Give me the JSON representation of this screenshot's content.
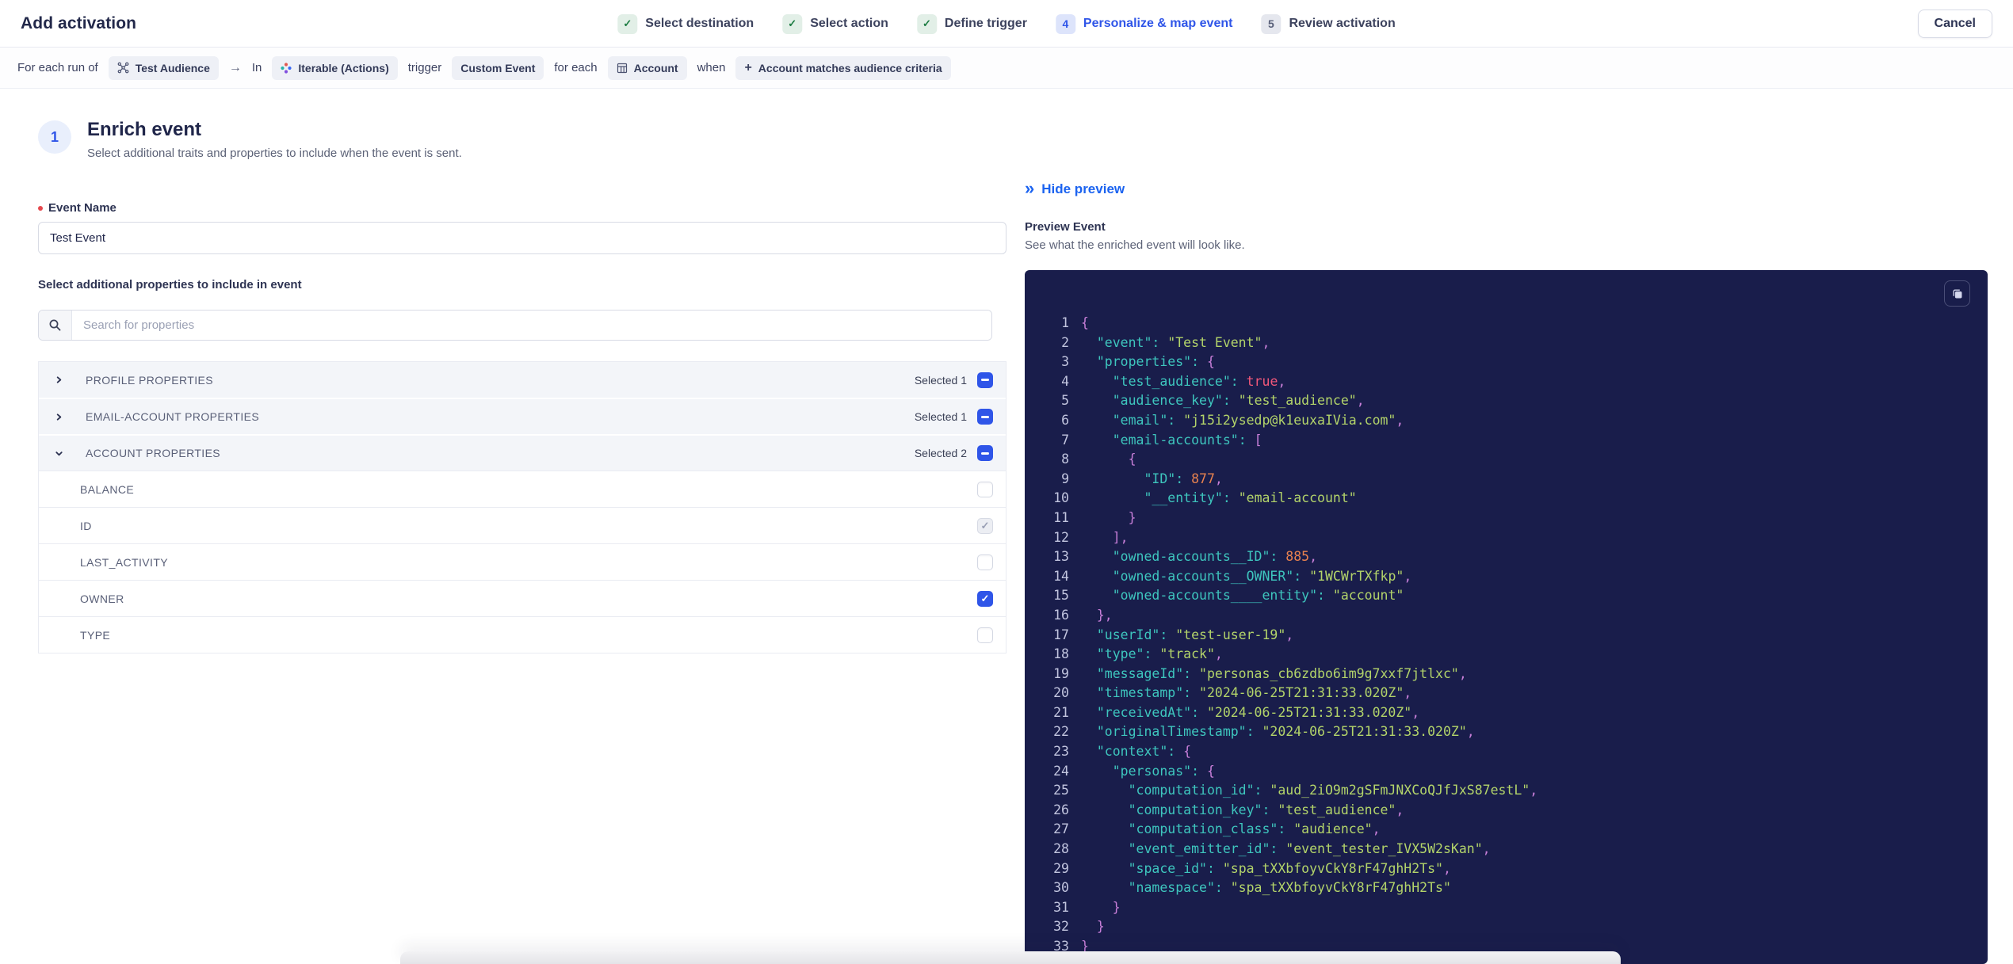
{
  "header": {
    "title": "Add activation",
    "cancel_label": "Cancel"
  },
  "steps": [
    {
      "label": "Select destination",
      "state": "done"
    },
    {
      "label": "Select action",
      "state": "done"
    },
    {
      "label": "Define trigger",
      "state": "done"
    },
    {
      "label": "Personalize & map event",
      "state": "active",
      "num": "4"
    },
    {
      "label": "Review activation",
      "state": "upcoming",
      "num": "5"
    }
  ],
  "context_bar": {
    "segments": [
      {
        "type": "text",
        "text": "For each run of"
      },
      {
        "type": "chip",
        "text": "Test Audience",
        "icon": "audience-network-icon"
      },
      {
        "type": "arrow",
        "text": "→"
      },
      {
        "type": "text",
        "text": "In"
      },
      {
        "type": "chip",
        "text": "Iterable (Actions)",
        "icon": "iterable-logo-icon"
      },
      {
        "type": "text",
        "text": "trigger"
      },
      {
        "type": "chip",
        "text": "Custom Event"
      },
      {
        "type": "text",
        "text": "for each"
      },
      {
        "type": "chip",
        "text": "Account",
        "icon": "table-icon"
      },
      {
        "type": "text",
        "text": "when"
      },
      {
        "type": "chip",
        "text": "Account matches audience criteria",
        "icon": "plus-icon"
      }
    ]
  },
  "enrich": {
    "step_number": "1",
    "title": "Enrich event",
    "subtitle": "Select additional traits and properties to include when the event is sent.",
    "event_name_label": "Event Name",
    "event_name_value": "Test Event",
    "properties_label": "Select additional properties to include in event",
    "search_placeholder": "Search for properties",
    "groups": [
      {
        "label": "PROFILE PROPERTIES",
        "selected_text": "Selected 1",
        "expanded": false,
        "children": []
      },
      {
        "label": "EMAIL-ACCOUNT PROPERTIES",
        "selected_text": "Selected 1",
        "expanded": false,
        "children": []
      },
      {
        "label": "ACCOUNT PROPERTIES",
        "selected_text": "Selected 2",
        "expanded": true,
        "children": [
          {
            "label": "BALANCE",
            "checkbox": "unchecked"
          },
          {
            "label": "ID",
            "checkbox": "checked-disabled"
          },
          {
            "label": "LAST_ACTIVITY",
            "checkbox": "unchecked"
          },
          {
            "label": "OWNER",
            "checkbox": "checked"
          },
          {
            "label": "TYPE",
            "checkbox": "unchecked"
          }
        ]
      }
    ]
  },
  "preview": {
    "hide_label": "Hide preview",
    "title": "Preview Event",
    "subtitle": "See what the enriched event will look like.",
    "code_lines": [
      [
        [
          "p",
          "{"
        ]
      ],
      [
        [
          "w",
          "  "
        ],
        [
          "k",
          "\"event\": "
        ],
        [
          "s",
          "\"Test Event\""
        ],
        [
          "p",
          ","
        ]
      ],
      [
        [
          "w",
          "  "
        ],
        [
          "k",
          "\"properties\": "
        ],
        [
          "p",
          "{"
        ]
      ],
      [
        [
          "w",
          "    "
        ],
        [
          "k",
          "\"test_audience\": "
        ],
        [
          "b",
          "true"
        ],
        [
          "p",
          ","
        ]
      ],
      [
        [
          "w",
          "    "
        ],
        [
          "k",
          "\"audience_key\": "
        ],
        [
          "s",
          "\"test_audience\""
        ],
        [
          "p",
          ","
        ]
      ],
      [
        [
          "w",
          "    "
        ],
        [
          "k",
          "\"email\": "
        ],
        [
          "s",
          "\"j15i2ysedp@k1euxaIVia.com\""
        ],
        [
          "p",
          ","
        ]
      ],
      [
        [
          "w",
          "    "
        ],
        [
          "k",
          "\"email-accounts\": "
        ],
        [
          "p",
          "["
        ]
      ],
      [
        [
          "w",
          "      "
        ],
        [
          "p",
          "{"
        ]
      ],
      [
        [
          "w",
          "        "
        ],
        [
          "k",
          "\"ID\": "
        ],
        [
          "n",
          "877"
        ],
        [
          "p",
          ","
        ]
      ],
      [
        [
          "w",
          "        "
        ],
        [
          "k",
          "\"__entity\": "
        ],
        [
          "s",
          "\"email-account\""
        ]
      ],
      [
        [
          "w",
          "      "
        ],
        [
          "p",
          "}"
        ]
      ],
      [
        [
          "w",
          "    "
        ],
        [
          "p",
          "],"
        ]
      ],
      [
        [
          "w",
          "    "
        ],
        [
          "k",
          "\"owned-accounts__ID\": "
        ],
        [
          "n",
          "885"
        ],
        [
          "p",
          ","
        ]
      ],
      [
        [
          "w",
          "    "
        ],
        [
          "k",
          "\"owned-accounts__OWNER\": "
        ],
        [
          "s",
          "\"1WCWrTXfkp\""
        ],
        [
          "p",
          ","
        ]
      ],
      [
        [
          "w",
          "    "
        ],
        [
          "k",
          "\"owned-accounts____entity\": "
        ],
        [
          "s",
          "\"account\""
        ]
      ],
      [
        [
          "w",
          "  "
        ],
        [
          "p",
          "},"
        ]
      ],
      [
        [
          "w",
          "  "
        ],
        [
          "k",
          "\"userId\": "
        ],
        [
          "s",
          "\"test-user-19\""
        ],
        [
          "p",
          ","
        ]
      ],
      [
        [
          "w",
          "  "
        ],
        [
          "k",
          "\"type\": "
        ],
        [
          "s",
          "\"track\""
        ],
        [
          "p",
          ","
        ]
      ],
      [
        [
          "w",
          "  "
        ],
        [
          "k",
          "\"messageId\": "
        ],
        [
          "s",
          "\"personas_cb6zdbo6im9g7xxf7jtlxc\""
        ],
        [
          "p",
          ","
        ]
      ],
      [
        [
          "w",
          "  "
        ],
        [
          "k",
          "\"timestamp\": "
        ],
        [
          "s",
          "\"2024-06-25T21:31:33.020Z\""
        ],
        [
          "p",
          ","
        ]
      ],
      [
        [
          "w",
          "  "
        ],
        [
          "k",
          "\"receivedAt\": "
        ],
        [
          "s",
          "\"2024-06-25T21:31:33.020Z\""
        ],
        [
          "p",
          ","
        ]
      ],
      [
        [
          "w",
          "  "
        ],
        [
          "k",
          "\"originalTimestamp\": "
        ],
        [
          "s",
          "\"2024-06-25T21:31:33.020Z\""
        ],
        [
          "p",
          ","
        ]
      ],
      [
        [
          "w",
          "  "
        ],
        [
          "k",
          "\"context\": "
        ],
        [
          "p",
          "{"
        ]
      ],
      [
        [
          "w",
          "    "
        ],
        [
          "k",
          "\"personas\": "
        ],
        [
          "p",
          "{"
        ]
      ],
      [
        [
          "w",
          "      "
        ],
        [
          "k",
          "\"computation_id\": "
        ],
        [
          "s",
          "\"aud_2iO9m2gSFmJNXCoQJfJxS87estL\""
        ],
        [
          "p",
          ","
        ]
      ],
      [
        [
          "w",
          "      "
        ],
        [
          "k",
          "\"computation_key\": "
        ],
        [
          "s",
          "\"test_audience\""
        ],
        [
          "p",
          ","
        ]
      ],
      [
        [
          "w",
          "      "
        ],
        [
          "k",
          "\"computation_class\": "
        ],
        [
          "s",
          "\"audience\""
        ],
        [
          "p",
          ","
        ]
      ],
      [
        [
          "w",
          "      "
        ],
        [
          "k",
          "\"event_emitter_id\": "
        ],
        [
          "s",
          "\"event_tester_IVX5W2sKan\""
        ],
        [
          "p",
          ","
        ]
      ],
      [
        [
          "w",
          "      "
        ],
        [
          "k",
          "\"space_id\": "
        ],
        [
          "s",
          "\"spa_tXXbfoyvCkY8rF47ghH2Ts\""
        ],
        [
          "p",
          ","
        ]
      ],
      [
        [
          "w",
          "      "
        ],
        [
          "k",
          "\"namespace\": "
        ],
        [
          "s",
          "\"spa_tXXbfoyvCkY8rF47ghH2Ts\""
        ]
      ],
      [
        [
          "w",
          "    "
        ],
        [
          "p",
          "}"
        ]
      ],
      [
        [
          "w",
          "  "
        ],
        [
          "p",
          "}"
        ]
      ],
      [
        [
          "p",
          "}"
        ]
      ]
    ]
  },
  "colors": {
    "accent_blue": "#2f55e8",
    "link_blue": "#1b63f0",
    "success_green": "#1c7c42",
    "code_bg": "#191d4b",
    "code_key": "#3ec6be",
    "code_string": "#b3d46a",
    "code_punct": "#c87fd9",
    "code_number": "#e8824f",
    "code_boolean": "#f2587a"
  }
}
